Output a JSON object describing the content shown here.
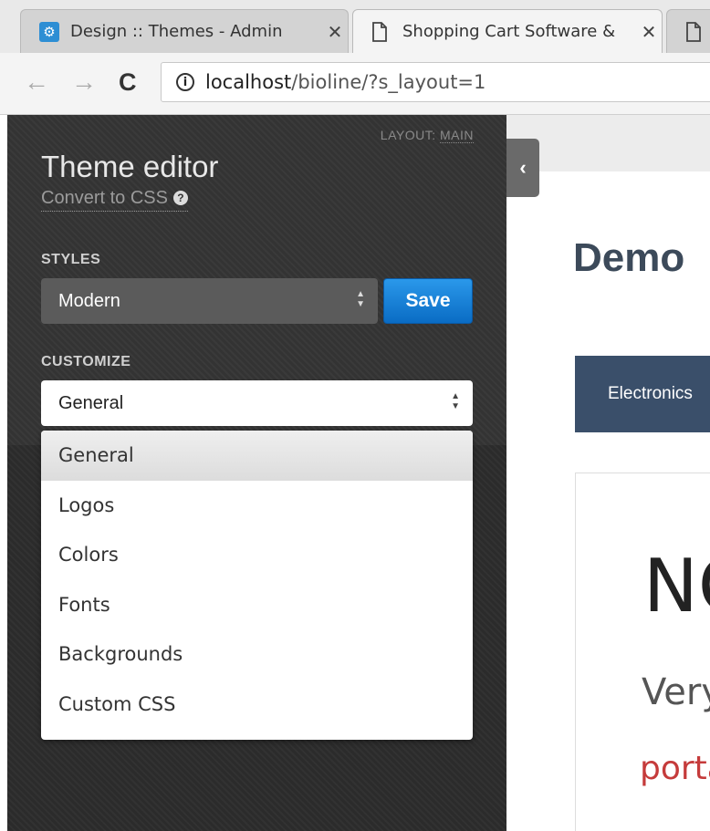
{
  "browser": {
    "tabs": [
      {
        "title": "Design :: Themes - Admin",
        "icon": "gear-favicon"
      },
      {
        "title": "Shopping Cart Software &",
        "icon": "document-icon"
      },
      {
        "title": "",
        "icon": "document-icon"
      }
    ],
    "close_glyph": "✕",
    "url_host": "localhost",
    "url_path": "/bioline/?s_layout=1"
  },
  "editor": {
    "layout_label": "LAYOUT:",
    "layout_value": "MAIN",
    "title": "Theme editor",
    "convert_link": "Convert to CSS",
    "styles_label": "STYLES",
    "styles_value": "Modern",
    "save_label": "Save",
    "customize_label": "CUSTOMIZE",
    "customize_value": "General",
    "customize_options": [
      "General",
      "Logos",
      "Colors",
      "Fonts",
      "Backgrounds",
      "Custom CSS"
    ],
    "selected_option": "General",
    "save_color": "#1a86dd"
  },
  "preview": {
    "heading": "Demo",
    "nav_item": "Electronics",
    "big_text": "NO",
    "line1": "Very",
    "line2": "porta",
    "nav_color": "#3a4f6a",
    "link_color": "#c53b3b"
  }
}
